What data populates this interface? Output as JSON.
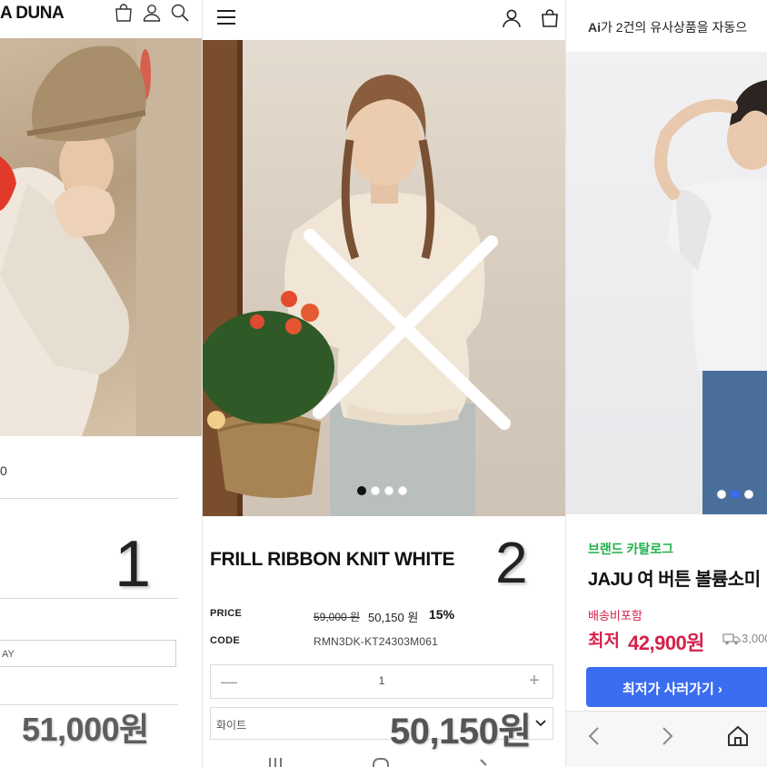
{
  "panel1": {
    "logo": "A DUNA",
    "icons": [
      "shopping-bag-icon",
      "user-icon",
      "search-icon"
    ],
    "partial_text": "0",
    "number_annotation": "1",
    "select_text": "AY",
    "price": "51,000원"
  },
  "panel2": {
    "header_icons": [
      "menu-icon",
      "user-icon",
      "shopping-bag-icon"
    ],
    "image_dots": {
      "count": 4,
      "active": 1
    },
    "title": "FRILL RIBBON KNIT WHITE",
    "number_annotation": "2",
    "price_label": "PRICE",
    "original_price": "59,000 원",
    "sale_price": "50,150 원",
    "discount": "15%",
    "code_label": "CODE",
    "code_value": "RMN3DK-KT24303M061",
    "quantity": "1",
    "minus": "—",
    "plus": "+",
    "option_selected": "화이트",
    "price_overlay": "50,150원"
  },
  "panel3": {
    "ai_banner_mark": "Ai",
    "ai_banner": "가 2건의 유사상품을 자동으",
    "image_dots": {
      "count": 3,
      "active": 2
    },
    "catalog_label": "브랜드 카탈로그",
    "product_title": "JAJU 여 버튼 볼륨소미",
    "shipping": "배송비포함",
    "lowest_label": "최저",
    "lowest_price": "42,900원",
    "delivery_price": "3,000",
    "buy_button": "최저가 사러가기 ›",
    "bottom_nav": [
      "back-icon",
      "forward-icon",
      "home-icon"
    ]
  },
  "colors": {
    "brand_green": "#1fb24a",
    "price_red": "#d4224a",
    "button_blue": "#3a6df0",
    "annotation_x": "#ffffff"
  }
}
